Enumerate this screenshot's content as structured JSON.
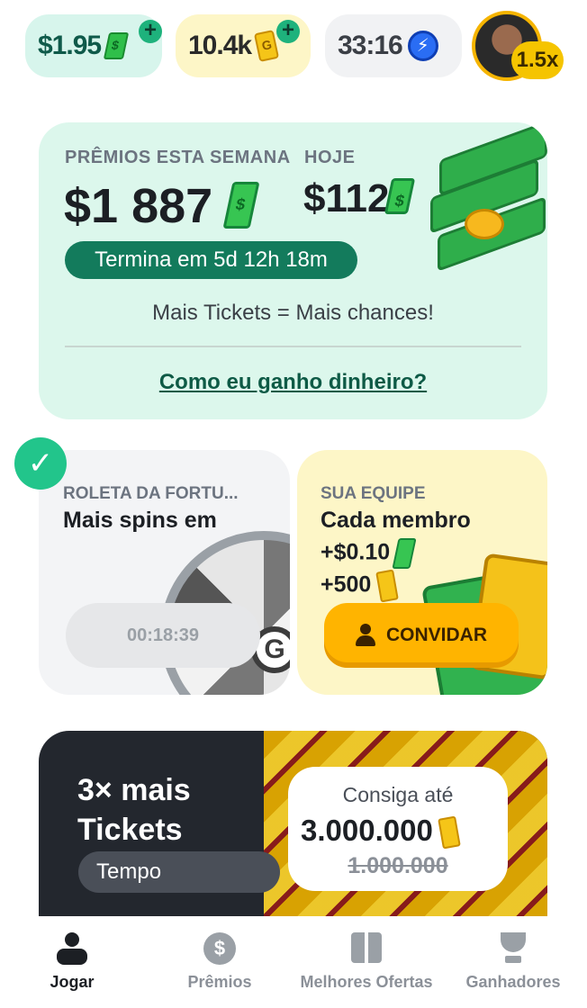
{
  "topbar": {
    "cash": "$1.95",
    "tickets": "10.4k",
    "timer": "33:16",
    "multiplier": "1.5x"
  },
  "prize_card": {
    "week_label": "PRÊMIOS ESTA SEMANA",
    "week_amount": "$1 887",
    "today_label": "HOJE",
    "today_amount": "$112",
    "ends_in": "Termina em 5d 12h 18m",
    "hint": "Mais Tickets = Mais chances!",
    "how_link": "Como eu ganho dinheiro?"
  },
  "roleta_card": {
    "label": "ROLETA DA FORTU...",
    "title": "Mais spins em",
    "timer": "00:18:39"
  },
  "team_card": {
    "label": "SUA EQUIPE",
    "title": "Cada membro",
    "cash_bonus": "+$0.10",
    "ticket_bonus": "+500",
    "invite_button": "CONVIDAR"
  },
  "promo": {
    "title_line1": "3× mais",
    "title_line2": "Tickets",
    "time_pill": "Tempo",
    "box_top": "Consiga até",
    "box_amount": "3.000.000",
    "box_old": "1.000.000"
  },
  "nav": {
    "items": [
      {
        "label": "Jogar",
        "icon": "joystick-icon",
        "active": true
      },
      {
        "label": "Prêmios",
        "icon": "dollar-icon",
        "active": false
      },
      {
        "label": "Melhores Ofertas",
        "icon": "gift-icon",
        "active": false
      },
      {
        "label": "Ganhadores",
        "icon": "trophy-icon",
        "active": false
      }
    ]
  },
  "colors": {
    "accent_green": "#137b5c",
    "mint_bg": "#dcf7ec",
    "yellow_bg": "#fdf6c7",
    "invite_orange": "#ffb400",
    "dark_banner": "#23272e"
  }
}
